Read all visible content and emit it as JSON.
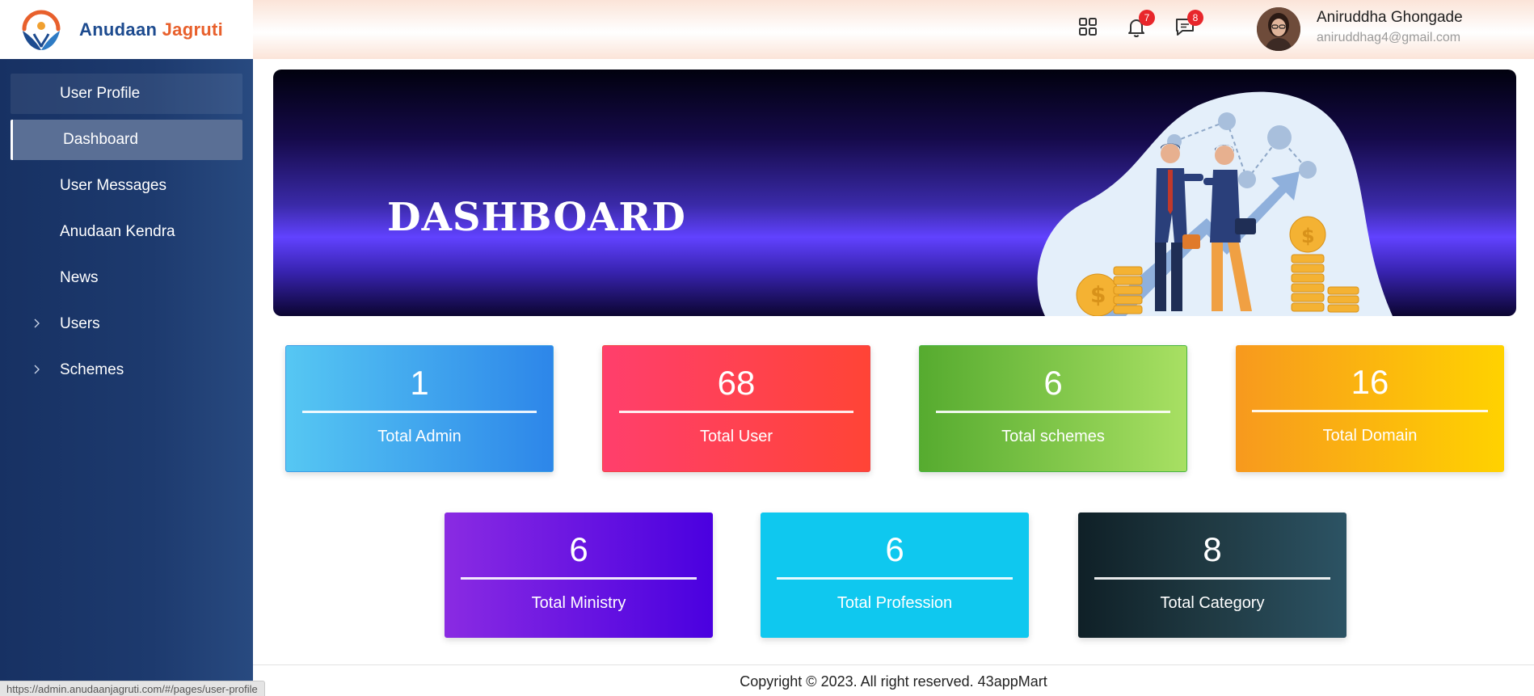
{
  "brand": {
    "name_part1": "Anudaan",
    "name_part2": "Jagruti"
  },
  "sidebar": {
    "items": [
      {
        "label": "User Profile"
      },
      {
        "label": "Dashboard"
      },
      {
        "label": "User Messages"
      },
      {
        "label": "Anudaan Kendra"
      },
      {
        "label": "News"
      },
      {
        "label": "Users"
      },
      {
        "label": "Schemes"
      }
    ]
  },
  "status_url": "https://admin.anudaanjagruti.com/#/pages/user-profile",
  "header": {
    "apps_icon": "grid-icon",
    "notifications_count": "7",
    "messages_count": "8",
    "user_name": "Aniruddha Ghongade",
    "user_email": "aniruddhag4@gmail.com"
  },
  "banner": {
    "title": "DASHBOARD"
  },
  "cards": {
    "admin": {
      "value": "1",
      "label": "Total Admin"
    },
    "user": {
      "value": "68",
      "label": "Total User"
    },
    "schemes": {
      "value": "6",
      "label": "Total schemes"
    },
    "domain": {
      "value": "16",
      "label": "Total Domain"
    },
    "ministry": {
      "value": "6",
      "label": "Total Ministry"
    },
    "profession": {
      "value": "6",
      "label": "Total Profession"
    },
    "category": {
      "value": "8",
      "label": "Total Category"
    }
  },
  "footer": {
    "text": "Copyright © 2023. All right reserved. 43appMart"
  },
  "colors": {
    "sidebar_bg": "#1d3a6e",
    "brand_blue": "#1d4b8f",
    "brand_orange": "#e8602c",
    "badge_red": "#e8262b",
    "banner_purple": "#6142ff"
  }
}
